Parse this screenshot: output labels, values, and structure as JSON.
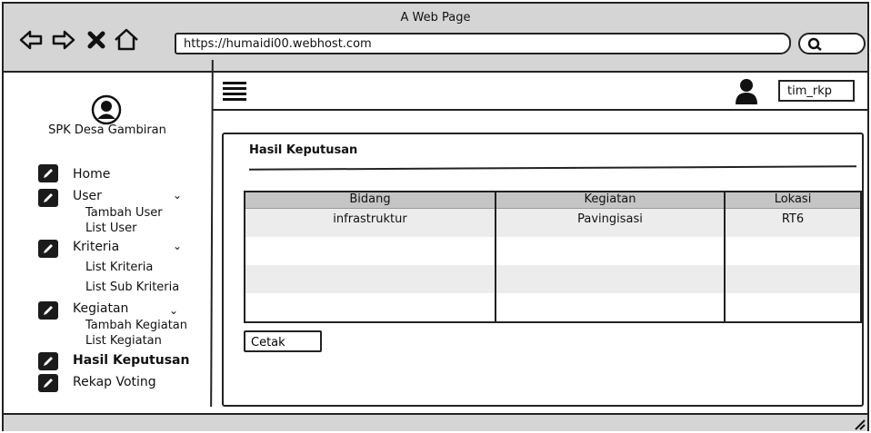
{
  "browser": {
    "window_title": "A Web Page",
    "url": "https://humaidi00.webhost.com",
    "icons": [
      "back-arrow-icon",
      "forward-arrow-icon",
      "close-x-icon",
      "home-icon",
      "search-icon"
    ]
  },
  "sidebar": {
    "app_name": "SPK Desa Gambiran",
    "menu": [
      {
        "label": "Home"
      },
      {
        "label": "User",
        "children": [
          "Tambah User",
          "List User"
        ]
      },
      {
        "label": "Kriteria",
        "children": [
          "List Kriteria",
          "List Sub Kriteria"
        ]
      },
      {
        "label": "Kegiatan",
        "children": [
          "Tambah Kegiatan",
          "List Kegiatan"
        ]
      },
      {
        "label": "Hasil Keputusan",
        "active": true
      },
      {
        "label": "Rekap Voting"
      }
    ]
  },
  "topbar": {
    "username": "tim_rkp"
  },
  "main": {
    "title": "Hasil Keputusan",
    "table": {
      "columns": [
        "Bidang",
        "Kegiatan",
        "Lokasi"
      ],
      "rows": [
        [
          "infrastruktur",
          "Pavingisasi",
          "RT6"
        ],
        [
          "",
          "",
          ""
        ],
        [
          "",
          "",
          ""
        ],
        [
          "",
          "",
          ""
        ]
      ]
    },
    "print_button": "Cetak"
  },
  "colors": {
    "chrome_bg": "#d5d5d5",
    "header_row": "#c5c5c5",
    "stripe_row": "#ececec",
    "ink": "#222222"
  }
}
